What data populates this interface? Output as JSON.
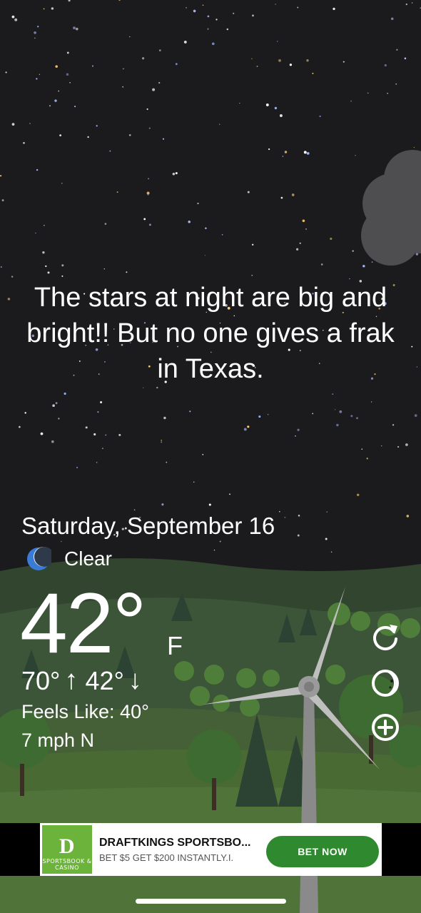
{
  "headline": "The stars at night are big and bright!! But no one gives a frak in Texas.",
  "weather": {
    "date": "Saturday, September 16",
    "condition_icon": "moon-icon",
    "condition": "Clear",
    "temperature": "42°",
    "unit": "F",
    "high": "70°",
    "low": "42°",
    "feels_like": "Feels Like: 40°",
    "wind": "7 mph N"
  },
  "controls": {
    "refresh_icon": "refresh-icon",
    "theme_icon": "moon-theme-icon",
    "add_icon": "add-location-icon"
  },
  "ad": {
    "logo_text": "SPORTSBOOK & CASINO",
    "title": "DRAFTKINGS SPORTSBO...",
    "subtitle": "BET $5 GET $200 INSTANTLY.I.",
    "button": "BET NOW"
  },
  "colors": {
    "sky": "#1b1b1d",
    "hills": "#3f5a3a",
    "ad_button": "#2f8a2f",
    "ad_logo": "#6bb33a",
    "moon": "#3a7bd5"
  }
}
